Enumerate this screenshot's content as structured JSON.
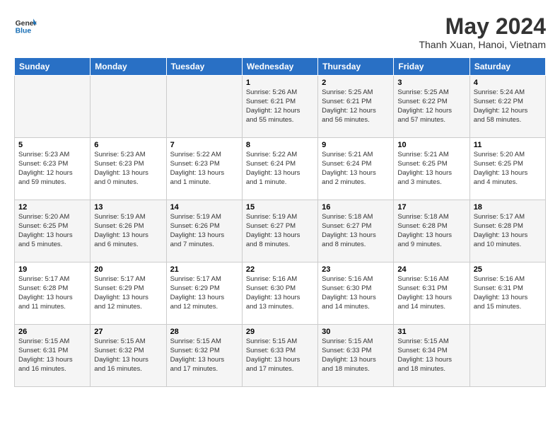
{
  "logo": {
    "line1": "General",
    "line2": "Blue"
  },
  "title": "May 2024",
  "subtitle": "Thanh Xuan, Hanoi, Vietnam",
  "weekdays": [
    "Sunday",
    "Monday",
    "Tuesday",
    "Wednesday",
    "Thursday",
    "Friday",
    "Saturday"
  ],
  "weeks": [
    [
      {
        "day": "",
        "info": ""
      },
      {
        "day": "",
        "info": ""
      },
      {
        "day": "",
        "info": ""
      },
      {
        "day": "1",
        "info": "Sunrise: 5:26 AM\nSunset: 6:21 PM\nDaylight: 12 hours\nand 55 minutes."
      },
      {
        "day": "2",
        "info": "Sunrise: 5:25 AM\nSunset: 6:21 PM\nDaylight: 12 hours\nand 56 minutes."
      },
      {
        "day": "3",
        "info": "Sunrise: 5:25 AM\nSunset: 6:22 PM\nDaylight: 12 hours\nand 57 minutes."
      },
      {
        "day": "4",
        "info": "Sunrise: 5:24 AM\nSunset: 6:22 PM\nDaylight: 12 hours\nand 58 minutes."
      }
    ],
    [
      {
        "day": "5",
        "info": "Sunrise: 5:23 AM\nSunset: 6:23 PM\nDaylight: 12 hours\nand 59 minutes."
      },
      {
        "day": "6",
        "info": "Sunrise: 5:23 AM\nSunset: 6:23 PM\nDaylight: 13 hours\nand 0 minutes."
      },
      {
        "day": "7",
        "info": "Sunrise: 5:22 AM\nSunset: 6:23 PM\nDaylight: 13 hours\nand 1 minute."
      },
      {
        "day": "8",
        "info": "Sunrise: 5:22 AM\nSunset: 6:24 PM\nDaylight: 13 hours\nand 1 minute."
      },
      {
        "day": "9",
        "info": "Sunrise: 5:21 AM\nSunset: 6:24 PM\nDaylight: 13 hours\nand 2 minutes."
      },
      {
        "day": "10",
        "info": "Sunrise: 5:21 AM\nSunset: 6:25 PM\nDaylight: 13 hours\nand 3 minutes."
      },
      {
        "day": "11",
        "info": "Sunrise: 5:20 AM\nSunset: 6:25 PM\nDaylight: 13 hours\nand 4 minutes."
      }
    ],
    [
      {
        "day": "12",
        "info": "Sunrise: 5:20 AM\nSunset: 6:25 PM\nDaylight: 13 hours\nand 5 minutes."
      },
      {
        "day": "13",
        "info": "Sunrise: 5:19 AM\nSunset: 6:26 PM\nDaylight: 13 hours\nand 6 minutes."
      },
      {
        "day": "14",
        "info": "Sunrise: 5:19 AM\nSunset: 6:26 PM\nDaylight: 13 hours\nand 7 minutes."
      },
      {
        "day": "15",
        "info": "Sunrise: 5:19 AM\nSunset: 6:27 PM\nDaylight: 13 hours\nand 8 minutes."
      },
      {
        "day": "16",
        "info": "Sunrise: 5:18 AM\nSunset: 6:27 PM\nDaylight: 13 hours\nand 8 minutes."
      },
      {
        "day": "17",
        "info": "Sunrise: 5:18 AM\nSunset: 6:28 PM\nDaylight: 13 hours\nand 9 minutes."
      },
      {
        "day": "18",
        "info": "Sunrise: 5:17 AM\nSunset: 6:28 PM\nDaylight: 13 hours\nand 10 minutes."
      }
    ],
    [
      {
        "day": "19",
        "info": "Sunrise: 5:17 AM\nSunset: 6:28 PM\nDaylight: 13 hours\nand 11 minutes."
      },
      {
        "day": "20",
        "info": "Sunrise: 5:17 AM\nSunset: 6:29 PM\nDaylight: 13 hours\nand 12 minutes."
      },
      {
        "day": "21",
        "info": "Sunrise: 5:17 AM\nSunset: 6:29 PM\nDaylight: 13 hours\nand 12 minutes."
      },
      {
        "day": "22",
        "info": "Sunrise: 5:16 AM\nSunset: 6:30 PM\nDaylight: 13 hours\nand 13 minutes."
      },
      {
        "day": "23",
        "info": "Sunrise: 5:16 AM\nSunset: 6:30 PM\nDaylight: 13 hours\nand 14 minutes."
      },
      {
        "day": "24",
        "info": "Sunrise: 5:16 AM\nSunset: 6:31 PM\nDaylight: 13 hours\nand 14 minutes."
      },
      {
        "day": "25",
        "info": "Sunrise: 5:16 AM\nSunset: 6:31 PM\nDaylight: 13 hours\nand 15 minutes."
      }
    ],
    [
      {
        "day": "26",
        "info": "Sunrise: 5:15 AM\nSunset: 6:31 PM\nDaylight: 13 hours\nand 16 minutes."
      },
      {
        "day": "27",
        "info": "Sunrise: 5:15 AM\nSunset: 6:32 PM\nDaylight: 13 hours\nand 16 minutes."
      },
      {
        "day": "28",
        "info": "Sunrise: 5:15 AM\nSunset: 6:32 PM\nDaylight: 13 hours\nand 17 minutes."
      },
      {
        "day": "29",
        "info": "Sunrise: 5:15 AM\nSunset: 6:33 PM\nDaylight: 13 hours\nand 17 minutes."
      },
      {
        "day": "30",
        "info": "Sunrise: 5:15 AM\nSunset: 6:33 PM\nDaylight: 13 hours\nand 18 minutes."
      },
      {
        "day": "31",
        "info": "Sunrise: 5:15 AM\nSunset: 6:34 PM\nDaylight: 13 hours\nand 18 minutes."
      },
      {
        "day": "",
        "info": ""
      }
    ]
  ]
}
